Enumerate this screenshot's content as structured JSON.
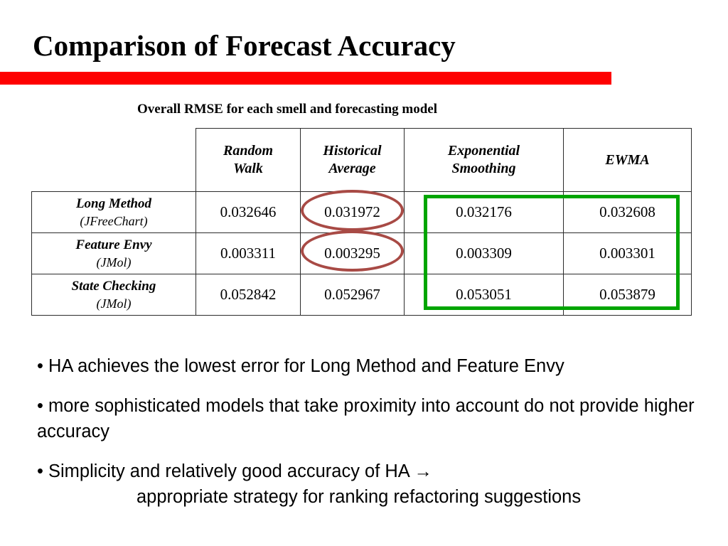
{
  "slide": {
    "title": "Comparison of Forecast Accuracy",
    "accent_color": "#fe0000",
    "table_caption": "Overall RMSE for each smell and forecasting model"
  },
  "table": {
    "corner_label": "",
    "columns": [
      "Random Walk",
      "Historical Average",
      "Exponential Smoothing",
      "EWMA"
    ],
    "columns_lines": [
      [
        "Random",
        "Walk"
      ],
      [
        "Historical",
        "Average"
      ],
      [
        "Exponential",
        "Smoothing"
      ],
      [
        "EWMA",
        ""
      ]
    ],
    "rows": [
      {
        "smell": "Long Method",
        "project": "(JFreeChart)",
        "values": [
          "0.032646",
          "0.031972",
          "0.032176",
          "0.032608"
        ]
      },
      {
        "smell": "Feature Envy",
        "project": "(JMol)",
        "values": [
          "0.003311",
          "0.003295",
          "0.003309",
          "0.003301"
        ]
      },
      {
        "smell": "State Checking",
        "project": "(JMol)",
        "values": [
          "0.052842",
          "0.052967",
          "0.053051",
          "0.053879"
        ]
      }
    ]
  },
  "annotations": {
    "ellipse_color": "#a84a45",
    "rect_color": "#00a500",
    "ellipse_targets": [
      "0.031972",
      "0.003295"
    ],
    "rect_target_columns": [
      "Exponential Smoothing",
      "EWMA"
    ]
  },
  "bullets": [
    {
      "text": "• HA achieves the lowest error for Long Method and Feature Envy",
      "continuation": ""
    },
    {
      "text": "• more sophisticated models that take proximity into account do not provide higher accuracy",
      "continuation": ""
    },
    {
      "text": "• Simplicity and relatively good accuracy of HA →",
      "continuation": "appropriate strategy for ranking refactoring suggestions"
    }
  ]
}
